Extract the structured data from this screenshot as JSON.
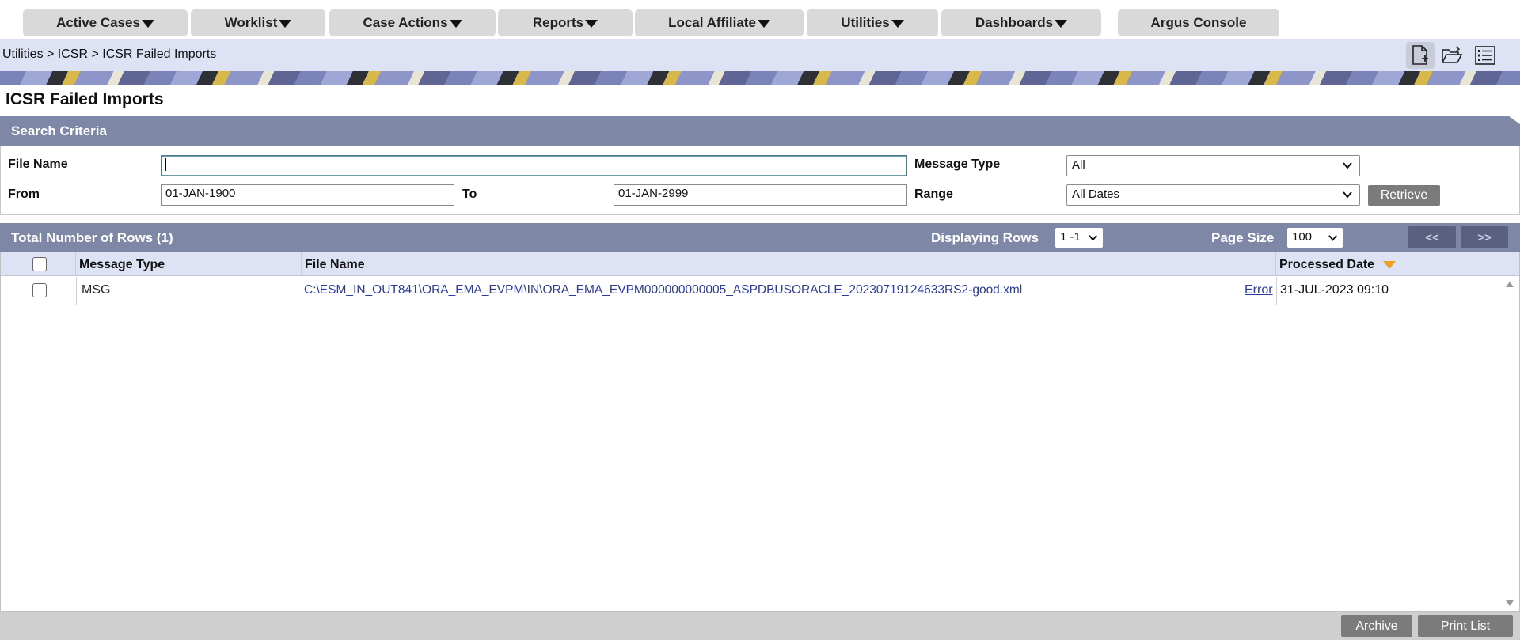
{
  "menu": {
    "items": [
      {
        "label": "Active Cases",
        "has_caret": true
      },
      {
        "label": "Worklist",
        "has_caret": true
      },
      {
        "label": "Case Actions",
        "has_caret": true
      },
      {
        "label": "Reports",
        "has_caret": true
      },
      {
        "label": "Local Affiliate",
        "has_caret": true
      },
      {
        "label": "Utilities",
        "has_caret": true
      },
      {
        "label": "Dashboards",
        "has_caret": true
      }
    ],
    "console": "Argus Console"
  },
  "breadcrumb": "Utilities > ICSR > ICSR Failed Imports",
  "toolbar_icons": [
    "new-document-icon",
    "open-folder-icon",
    "list-view-icon"
  ],
  "page_title": "ICSR Failed Imports",
  "search": {
    "header": "Search Criteria",
    "file_name_label": "File Name",
    "file_name_value": "",
    "message_type_label": "Message Type",
    "message_type_value": "All",
    "from_label": "From",
    "from_value": "01-JAN-1900",
    "to_label": "To",
    "to_value": "01-JAN-2999",
    "range_label": "Range",
    "range_value": "All Dates",
    "retrieve_label": "Retrieve"
  },
  "results": {
    "total_label": "Total Number of Rows (1)",
    "displaying_label": "Displaying Rows",
    "displaying_value": "1 -1",
    "page_size_label": "Page Size",
    "page_size_value": "100",
    "prev_label": "<<",
    "next_label": ">>",
    "columns": {
      "message_type": "Message Type",
      "file_name": "File Name",
      "processed_date": "Processed Date"
    },
    "rows": [
      {
        "message_type": "MSG",
        "file_name": "C:\\ESM_IN_OUT841\\ORA_EMA_EVPM\\IN\\ORA_EMA_EVPM000000000005_ASPDBUSORACLE_20230719124633RS2-good.xml",
        "error_link": "Error",
        "processed_date": "31-JUL-2023 09:10"
      }
    ]
  },
  "footer": {
    "archive_label": "Archive",
    "print_label": "Print List"
  },
  "colors": {
    "section_header": "#7e87a6",
    "crumb_bar": "#dde3f4",
    "link": "#2b3aa0",
    "sort_indicator": "#f0a020"
  }
}
